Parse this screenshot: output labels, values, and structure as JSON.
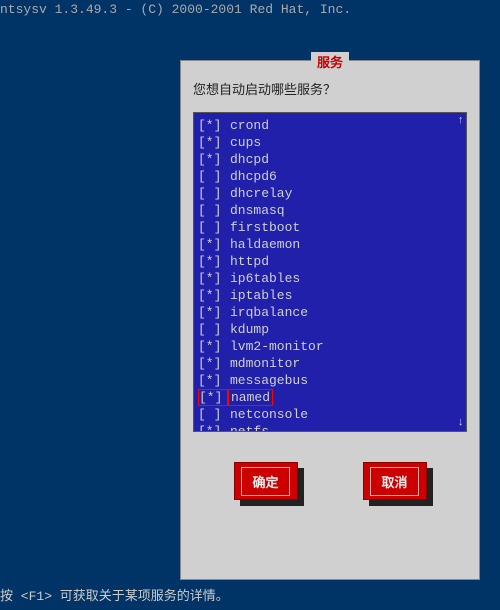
{
  "header": "ntsysv 1.3.49.3 - (C) 2000-2001 Red Hat, Inc.",
  "dialog": {
    "title": "服务",
    "prompt": "您想自动启动哪些服务？"
  },
  "services": [
    {
      "checked": true,
      "name": "crond",
      "highlighted": false
    },
    {
      "checked": true,
      "name": "cups",
      "highlighted": false
    },
    {
      "checked": true,
      "name": "dhcpd",
      "highlighted": false
    },
    {
      "checked": false,
      "name": "dhcpd6",
      "highlighted": false
    },
    {
      "checked": false,
      "name": "dhcrelay",
      "highlighted": false
    },
    {
      "checked": false,
      "name": "dnsmasq",
      "highlighted": false
    },
    {
      "checked": false,
      "name": "firstboot",
      "highlighted": false
    },
    {
      "checked": true,
      "name": "haldaemon",
      "highlighted": false
    },
    {
      "checked": true,
      "name": "httpd",
      "highlighted": false
    },
    {
      "checked": true,
      "name": "ip6tables",
      "highlighted": false
    },
    {
      "checked": true,
      "name": "iptables",
      "highlighted": false
    },
    {
      "checked": true,
      "name": "irqbalance",
      "highlighted": false
    },
    {
      "checked": false,
      "name": "kdump",
      "highlighted": false
    },
    {
      "checked": true,
      "name": "lvm2-monitor",
      "highlighted": false
    },
    {
      "checked": true,
      "name": "mdmonitor",
      "highlighted": false
    },
    {
      "checked": true,
      "name": "messagebus",
      "highlighted": false
    },
    {
      "checked": true,
      "name": "named",
      "highlighted": true
    },
    {
      "checked": false,
      "name": "netconsole",
      "highlighted": false
    },
    {
      "checked": true,
      "name": "netfs",
      "highlighted": false
    }
  ],
  "buttons": {
    "ok": "确定",
    "cancel": "取消"
  },
  "scroll": {
    "up": "↑",
    "down": "↓"
  },
  "footer": "按 <F1> 可获取关于某项服务的详情。"
}
